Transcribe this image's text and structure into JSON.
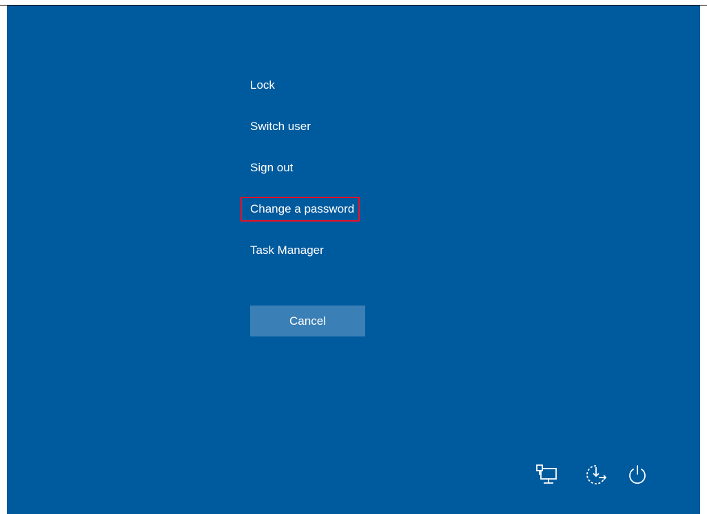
{
  "security_screen": {
    "options": [
      {
        "label": "Lock"
      },
      {
        "label": "Switch user"
      },
      {
        "label": "Sign out"
      },
      {
        "label": "Change a password",
        "highlighted": true
      },
      {
        "label": "Task Manager"
      }
    ],
    "cancel_label": "Cancel"
  },
  "tray_icons": [
    {
      "icon": "network-icon"
    },
    {
      "icon": "ease-of-access-icon"
    },
    {
      "icon": "power-icon"
    }
  ],
  "colors": {
    "background": "#005a9e",
    "cancel_button": "#3a7fb6",
    "text": "#ffffff",
    "highlight_outline": "#e81123"
  }
}
